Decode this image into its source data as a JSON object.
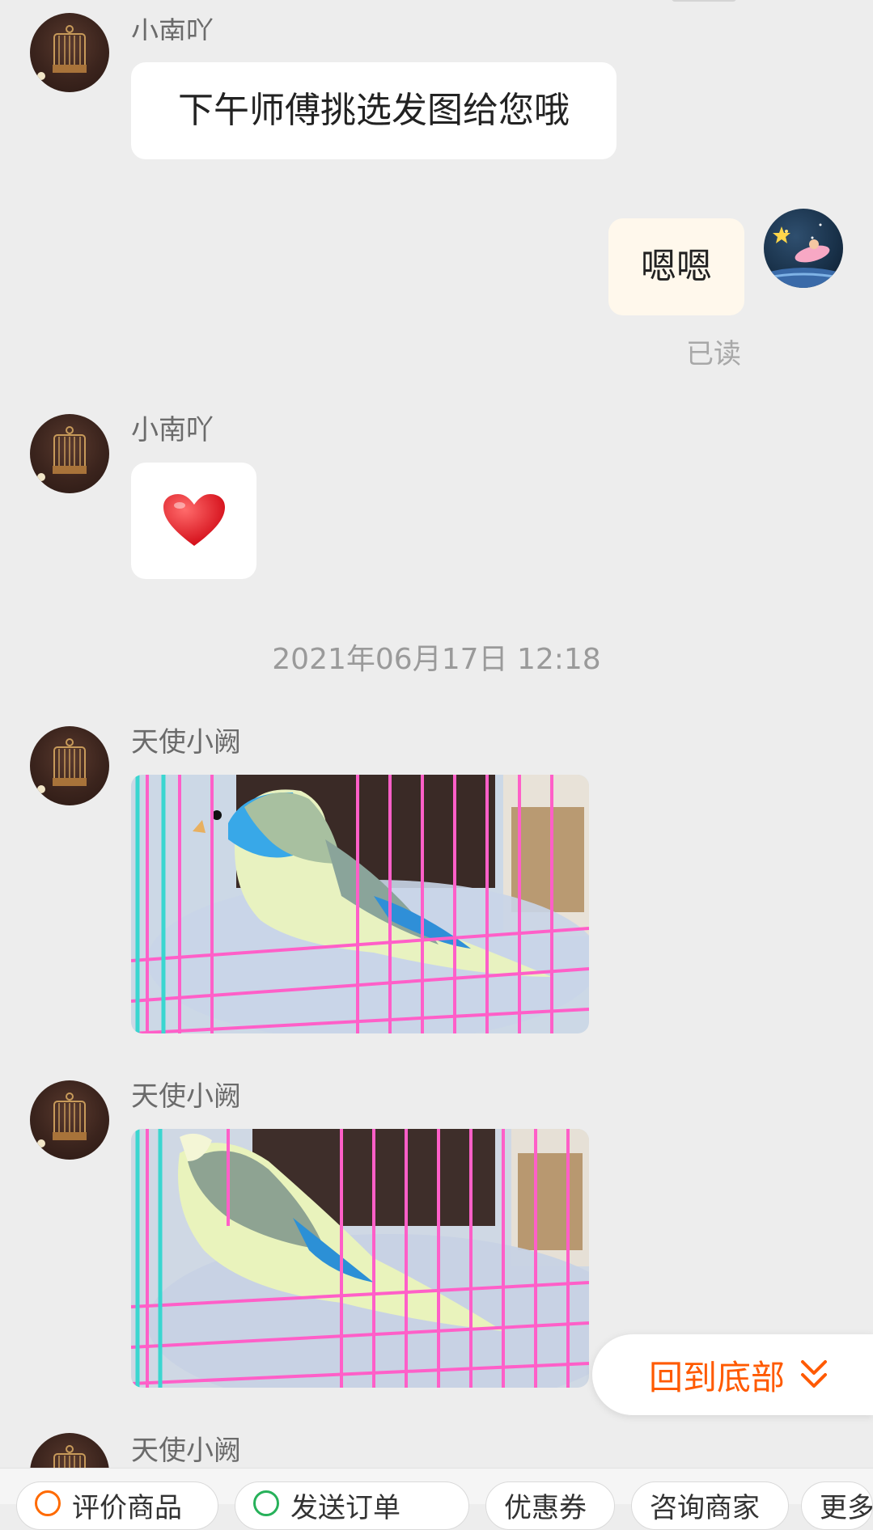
{
  "messages": [
    {
      "sender": "小南吖",
      "text": "下午师傅挑选发图给您哦"
    },
    {
      "sender": "me",
      "text": "嗯嗯",
      "status": "已读"
    },
    {
      "sender": "小南吖",
      "emoji": "heart"
    },
    {
      "timestamp": "2021年06月17日 12:18"
    },
    {
      "sender": "天使小阙",
      "image": "budgie-photo-1"
    },
    {
      "sender": "天使小阙",
      "image": "budgie-photo-2"
    },
    {
      "sender": "天使小阙"
    }
  ],
  "back_to_bottom": {
    "label": "回到底部",
    "icon": "double-chevron-down-icon"
  },
  "quick_replies": [
    "评价商品",
    "发送订单",
    "优惠券",
    "咨询商家",
    "更多"
  ],
  "colors": {
    "accent": "#ff5a00",
    "background": "#ededed",
    "bubble_me": "#fff8ec"
  }
}
